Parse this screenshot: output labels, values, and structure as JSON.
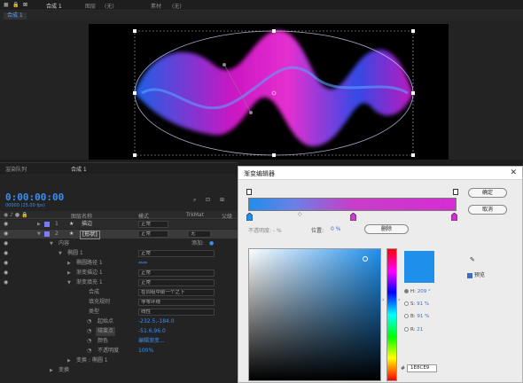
{
  "viewer": {
    "tabs": [
      "合成 1",
      "(无)",
      "(无)"
    ],
    "tab_prefixes": [
      "⊠",
      "图层",
      "素材"
    ],
    "sub_tab": "合成 1"
  },
  "timeline": {
    "panel_tab": "渲染队列",
    "comp_tab": "合成 1",
    "time": "0:00:00:00",
    "time_sub": "00000 (25.00 fps)",
    "columns": {
      "source_name": "图层名称",
      "mode": "模式",
      "trkmat": "TrkMat",
      "parent": "父级"
    },
    "layers": [
      {
        "num": "1",
        "name": "描边",
        "mode": "正常"
      },
      {
        "num": "2",
        "name": "[形状]",
        "mode": "正常",
        "trkmat": "无"
      }
    ],
    "props": {
      "contents": "内容",
      "add": "添加:",
      "group": "椭圆 1",
      "group_mode": "正常",
      "ellipse_path": "椭圆路径 1",
      "gradient_stroke": "渐变描边 1",
      "gradient_fill": "渐变填充 1",
      "gradient_mode_1": "正常",
      "gradient_mode_2": "正常",
      "composite": "合成",
      "composite_value": "在同组中前一个之下",
      "fill_rule": "填充规则",
      "fill_rule_value": "非零环绕",
      "type": "类型",
      "type_value": "线性",
      "start_point": "起始点",
      "start_value": "-232.5,-184.0",
      "end_point": "结束点",
      "end_value": "-51.6,96.0",
      "colors": "颜色",
      "colors_value": "编辑渐变...",
      "opacity": "不透明度",
      "opacity_value": "100%",
      "transform": "变换 : 椭圆 1",
      "transform_label": "变换"
    }
  },
  "dialog": {
    "title": "渐变编辑器",
    "ok": "确定",
    "cancel": "取消",
    "opacity_label": "不透明度: - %",
    "location_label": "位置:",
    "location_value": "0 %",
    "delete": "删除",
    "hue_label": "H:",
    "hue_value": "209 °",
    "s_label": "S:",
    "s_value": "91 %",
    "b_label": "B:",
    "b_value": "91 %",
    "r_label": "R:",
    "r_value": "21",
    "hex": "1E8CE9",
    "eyedropper": "吸管",
    "preview": "预览"
  },
  "colors": {
    "accent": "#3d8ef0",
    "stop_color": "#1f8fec",
    "gradient_end": "#d62cd3"
  }
}
